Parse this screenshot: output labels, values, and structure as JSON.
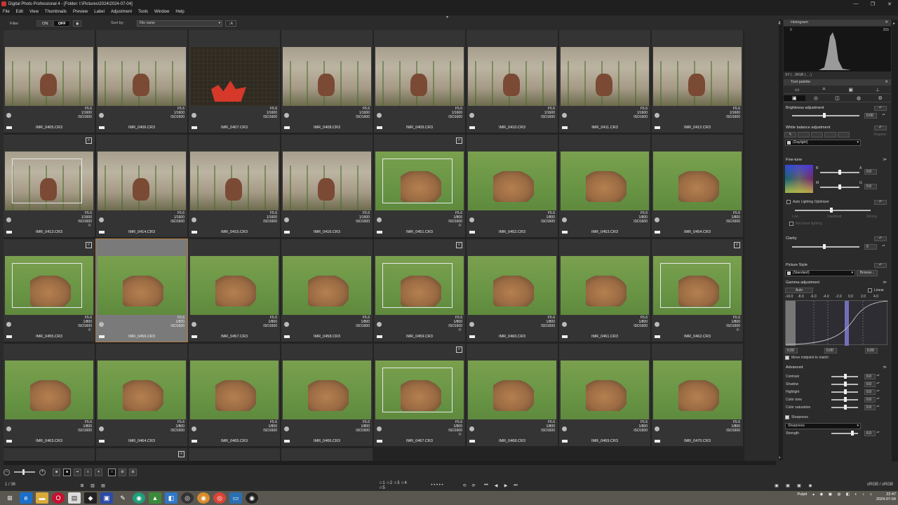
{
  "window": {
    "title": "Digital Photo Professional 4 - [Folder: I:\\Pictures\\2024\\2024-07-04]",
    "controls": [
      "—",
      "❐",
      "✕"
    ]
  },
  "menu": [
    "File",
    "Edit",
    "View",
    "Thumbnails",
    "Preview",
    "Label",
    "Adjustment",
    "Tools",
    "Window",
    "Help"
  ],
  "filter": {
    "label": "Filter",
    "on": "ON",
    "off": "OFF",
    "sort_label": "Sort by:",
    "sort_value": "File name"
  },
  "thumbnails": [
    {
      "file": "IMR_0405.CR3",
      "f": "F5.6",
      "shutter": "1/1600",
      "iso": "ISO1600",
      "scene": "rock"
    },
    {
      "file": "IMR_0406.CR3",
      "f": "F5.6",
      "shutter": "1/1600",
      "iso": "ISO1600",
      "scene": "rock"
    },
    {
      "file": "IMR_0407.CR3",
      "f": "F5.6",
      "shutter": "1/1600",
      "iso": "ISO1600",
      "scene": "grid"
    },
    {
      "file": "IMR_0408.CR3",
      "f": "F5.6",
      "shutter": "1/1600",
      "iso": "ISO1600",
      "scene": "rock"
    },
    {
      "file": "IMR_0409.CR3",
      "f": "F5.6",
      "shutter": "1/1600",
      "iso": "ISO1600",
      "scene": "rock"
    },
    {
      "file": "IMR_0410.CR3",
      "f": "F5.6",
      "shutter": "1/1600",
      "iso": "ISO1600",
      "scene": "rock"
    },
    {
      "file": "IMR_0411.CR3",
      "f": "F5.6",
      "shutter": "1/1600",
      "iso": "ISO1600",
      "scene": "rock"
    },
    {
      "file": "IMR_0412.CR3",
      "f": "F5.6",
      "shutter": "1/1600",
      "iso": "ISO1600",
      "scene": "rock"
    },
    {
      "file": "IMR_0413.CR3",
      "f": "F5.6",
      "shutter": "1/1600",
      "iso": "ISO1600",
      "scene": "rock",
      "focus": true
    },
    {
      "file": "IMR_0414.CR3",
      "f": "F5.6",
      "shutter": "1/1600",
      "iso": "ISO1600",
      "scene": "rock"
    },
    {
      "file": "IMR_0415.CR3",
      "f": "F5.6",
      "shutter": "1/1600",
      "iso": "ISO1600",
      "scene": "rock"
    },
    {
      "file": "IMR_0416.CR3",
      "f": "F5.6",
      "shutter": "1/1600",
      "iso": "ISO1600",
      "scene": "rock"
    },
    {
      "file": "IMR_0451.CR3",
      "f": "F5.6",
      "shutter": "1/800",
      "iso": "ISO1600",
      "scene": "grass",
      "focus": true
    },
    {
      "file": "IMR_0452.CR3",
      "f": "F5.6",
      "shutter": "1/800",
      "iso": "ISO1600",
      "scene": "grass"
    },
    {
      "file": "IMR_0453.CR3",
      "f": "F5.6",
      "shutter": "1/800",
      "iso": "ISO1600",
      "scene": "grass"
    },
    {
      "file": "IMR_0454.CR3",
      "f": "F5.6",
      "shutter": "1/800",
      "iso": "ISO1600",
      "scene": "grass"
    },
    {
      "file": "IMR_0455.CR3",
      "f": "F5.6",
      "shutter": "1/800",
      "iso": "ISO1600",
      "scene": "grass",
      "focus": true
    },
    {
      "file": "IMR_0456.CR3",
      "f": "F5.6",
      "shutter": "1/800",
      "iso": "ISO1600",
      "scene": "grass",
      "selected": true
    },
    {
      "file": "IMR_0457.CR3",
      "f": "F5.6",
      "shutter": "1/800",
      "iso": "ISO1600",
      "scene": "grass"
    },
    {
      "file": "IMR_0458.CR3",
      "f": "F5.6",
      "shutter": "1/800",
      "iso": "ISO1600",
      "scene": "grass"
    },
    {
      "file": "IMR_0459.CR3",
      "f": "F5.6",
      "shutter": "1/800",
      "iso": "ISO1600",
      "scene": "grass",
      "focus": true
    },
    {
      "file": "IMR_0460.CR3",
      "f": "F5.6",
      "shutter": "1/800",
      "iso": "ISO1600",
      "scene": "grass"
    },
    {
      "file": "IMR_0461.CR3",
      "f": "F5.6",
      "shutter": "1/800",
      "iso": "ISO1600",
      "scene": "grass"
    },
    {
      "file": "IMR_0462.CR3",
      "f": "F5.6",
      "shutter": "1/800",
      "iso": "ISO1600",
      "scene": "grass",
      "focus": true
    },
    {
      "file": "IMR_0463.CR3",
      "f": "F5.6",
      "shutter": "1/800",
      "iso": "ISO1600",
      "scene": "grass"
    },
    {
      "file": "IMR_0464.CR3",
      "f": "F5.6",
      "shutter": "1/800",
      "iso": "ISO1600",
      "scene": "grass"
    },
    {
      "file": "IMR_0465.CR3",
      "f": "F5.6",
      "shutter": "1/800",
      "iso": "ISO1600",
      "scene": "grass"
    },
    {
      "file": "IMR_0466.CR3",
      "f": "F5.6",
      "shutter": "1/800",
      "iso": "ISO1600",
      "scene": "grass"
    },
    {
      "file": "IMR_0467.CR3",
      "f": "F5.6",
      "shutter": "1/800",
      "iso": "ISO1600",
      "scene": "grass",
      "focus": true
    },
    {
      "file": "IMR_0468.CR3",
      "f": "F5.6",
      "shutter": "1/800",
      "iso": "ISO1600",
      "scene": "grass"
    },
    {
      "file": "IMR_0469.CR3",
      "f": "F5.6",
      "shutter": "1/800",
      "iso": "ISO1600",
      "scene": "grass"
    },
    {
      "file": "IMR_0470.CR3",
      "f": "F5.6",
      "shutter": "1/800",
      "iso": "ISO1600",
      "scene": "grass"
    }
  ],
  "status": {
    "count": "1 / 36",
    "color_space": "sRGB / sRGB"
  },
  "panel": {
    "histogram_title": "Histogram",
    "hist_low": "0",
    "hist_high": "255",
    "xy_readout": "XY (   ,   )RGB (   ,   ,   )",
    "tool_palette": "Tool palette",
    "brightness_label": "Brightness adjustment",
    "brightness_value": "0.00",
    "wb_label": "White balance adjustment",
    "wb_register": "Register",
    "wb_value": "(Daylight)",
    "finetune_label": "Fine-tune",
    "ft_b": "B",
    "ft_a": "A",
    "ft_m": "M",
    "ft_g": "G",
    "ft_ba_value": "0.0",
    "ft_mg_value": "0.0",
    "alo_label": "Auto Lighting Optimizer",
    "alo_levels": [
      "Low",
      "Standard",
      "Strong"
    ],
    "alo_sub": "Not more lighting",
    "clarity_label": "Clarity",
    "clarity_value": "0",
    "ps_label": "Picture Style",
    "ps_value": "(Standard)",
    "ps_browse": "Browse...",
    "gamma_label": "Gamma adjustment",
    "gamma_auto": "Auto",
    "gamma_linear": "Linear",
    "gamma_ticks": [
      "-10.0",
      "-8.0",
      "-6.0",
      "-4.0",
      "-2.0",
      "0.0",
      "2.0",
      "4.0"
    ],
    "gamma_vals": [
      "0.00",
      "0.00",
      "0.00"
    ],
    "midpoint_label": "Move midpoint to match",
    "advanced_label": "Advanced",
    "advanced": [
      {
        "label": "Contrast",
        "value": "0.0"
      },
      {
        "label": "Shadow",
        "value": "0.0"
      },
      {
        "label": "Highlight",
        "value": "0.0"
      },
      {
        "label": "Color tone",
        "value": "0.0"
      },
      {
        "label": "Color saturation",
        "value": "0.0"
      }
    ],
    "sharpness_label": "Sharpness",
    "sharpness_mode": "Sharpness",
    "strength_label": "Strength",
    "strength_value": "6.0"
  },
  "tray": {
    "weather": "Pulpit",
    "time": "22:47",
    "date": "2024-07-04"
  }
}
